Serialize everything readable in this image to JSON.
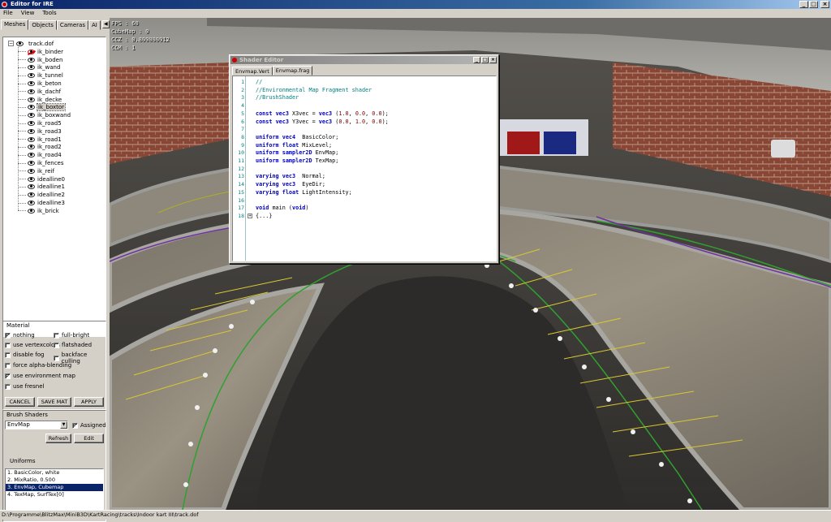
{
  "window": {
    "title": "Editor for IRE"
  },
  "menu": [
    "File",
    "View",
    "Tools"
  ],
  "left_tabs": [
    "Meshes",
    "Objects",
    "Cameras",
    "AI"
  ],
  "tree": {
    "root": "track.dof",
    "items": [
      {
        "label": "ik_binder",
        "visible": false
      },
      {
        "label": "ik_boden",
        "visible": true
      },
      {
        "label": "ik_wand",
        "visible": true
      },
      {
        "label": "ik_tunnel",
        "visible": true
      },
      {
        "label": "ik_beton",
        "visible": true
      },
      {
        "label": "ik_dachf",
        "visible": true
      },
      {
        "label": "ik_decke",
        "visible": true
      },
      {
        "label": "ik_boxtor",
        "visible": true,
        "selected": true
      },
      {
        "label": "ik_boxwand",
        "visible": true
      },
      {
        "label": "ik_road5",
        "visible": true
      },
      {
        "label": "ik_road3",
        "visible": true
      },
      {
        "label": "ik_road1",
        "visible": true
      },
      {
        "label": "ik_road2",
        "visible": true
      },
      {
        "label": "ik_road4",
        "visible": true
      },
      {
        "label": "ik_fences",
        "visible": true
      },
      {
        "label": "ik_reif",
        "visible": true
      },
      {
        "label": "idealline0",
        "visible": true
      },
      {
        "label": "idealline1",
        "visible": true
      },
      {
        "label": "idealline2",
        "visible": true
      },
      {
        "label": "idealline3",
        "visible": true
      },
      {
        "label": "ik_brick",
        "visible": true
      }
    ]
  },
  "material": {
    "title": "Material",
    "options": [
      {
        "label": "nothing",
        "checked": true
      },
      {
        "label": "full-bright",
        "checked": false
      },
      {
        "label": "use vertexcolors",
        "checked": false
      },
      {
        "label": "flatshaded",
        "checked": false
      },
      {
        "label": "disable fog",
        "checked": false
      },
      {
        "label": "backface culling",
        "checked": false
      },
      {
        "label": "force alpha-blending",
        "checked": false
      },
      {
        "label": "use environment map",
        "checked": true
      },
      {
        "label": "use fresnel",
        "checked": false
      }
    ],
    "buttons": {
      "cancel": "CANCEL",
      "save": "SAVE MAT",
      "apply": "APPLY"
    }
  },
  "brush": {
    "title": "Brush Shaders",
    "selected": "EnvMap",
    "assigned_label": "Assigned",
    "assigned": true,
    "refresh": "Refresh",
    "edit": "Edit",
    "uniforms_title": "Uniforms",
    "uniforms": [
      "1. BasicColor, white",
      "2. MixRatio, 0.500",
      "3. EnvMap, Cubemap",
      "4. TexMap, SurfTex[0]"
    ],
    "selected_uniform": 2
  },
  "overlay": [
    "FPS : 60",
    "CubeMap : 0",
    "CCZ : 0.800000012",
    "CCM : 1"
  ],
  "shader_editor": {
    "title": "Shader Editor",
    "tabs": [
      "Envmap.Vert",
      "Envmap.frag"
    ],
    "active_tab": 1,
    "lines": [
      {
        "n": "1",
        "text": "//",
        "type": "comment"
      },
      {
        "n": "2",
        "text": "//Environmental Map Fragment shader",
        "type": "comment"
      },
      {
        "n": "3",
        "text": "//BrushShader",
        "type": "comment"
      },
      {
        "n": "4",
        "text": "",
        "type": "plain"
      },
      {
        "n": "5",
        "text": "const vec3 X3vec = vec3 (1.0, 0.0, 0.0);",
        "type": "code"
      },
      {
        "n": "6",
        "text": "const vec3 Y3vec = vec3 (0.0, 1.0, 0.0);",
        "type": "code"
      },
      {
        "n": "7",
        "text": "",
        "type": "plain"
      },
      {
        "n": "8",
        "text": "uniform vec4  BasicColor;",
        "type": "code"
      },
      {
        "n": "9",
        "text": "uniform float MixLevel;",
        "type": "code"
      },
      {
        "n": "10",
        "text": "uniform sampler2D EnvMap;",
        "type": "code"
      },
      {
        "n": "11",
        "text": "uniform sampler2D TexMap;",
        "type": "code"
      },
      {
        "n": "12",
        "text": "",
        "type": "plain"
      },
      {
        "n": "13",
        "text": "varying vec3  Normal;",
        "type": "code"
      },
      {
        "n": "14",
        "text": "varying vec3  EyeDir;",
        "type": "code"
      },
      {
        "n": "15",
        "text": "varying float LightIntensity;",
        "type": "code"
      },
      {
        "n": "16",
        "text": "",
        "type": "plain"
      },
      {
        "n": "17",
        "text": "void main (void)",
        "type": "code"
      },
      {
        "n": "18",
        "text": "{...}",
        "type": "code"
      }
    ]
  },
  "status": "D:\\Programme\\BlitzMax\\MiniB3D\\KartRacing\\tracks\\Indoor kart III\\track.dof",
  "colors": {
    "titlebar": "#0a246a",
    "face": "#d4d0c8",
    "selection": "#0a246a"
  }
}
